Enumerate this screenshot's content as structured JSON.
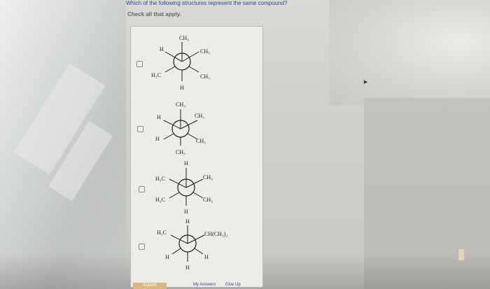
{
  "question": "Which of the following structures represent the same compound?",
  "instruction": "Check all that apply.",
  "options": [
    {
      "front_top": "CH₃",
      "front_left": "H",
      "front_right": "H",
      "back_top_right": "CH₃",
      "back_bottom_left": "H₃C",
      "back_bottom_right": "CH₃",
      "front_bottom": "H"
    },
    {
      "front_top": "CH₃",
      "front_left": "H",
      "front_right": "H",
      "back_top_right": "CH₃",
      "back_bottom_left": "H",
      "back_bottom_right": "CH₃",
      "front_bottom": "CH₃"
    },
    {
      "front_top": "H",
      "front_left": "H₃C",
      "front_right": "H",
      "back_top_right": "CH₃",
      "back_bottom_left": "H₃C",
      "back_bottom_right": "CH₃",
      "front_bottom": "H"
    },
    {
      "front_top": "H",
      "front_left": "H₃C",
      "front_right": "H",
      "back_top_right": "CH(CH₃)₂",
      "back_bottom_left": "H",
      "back_bottom_right": "H",
      "front_bottom": "H"
    }
  ],
  "buttons": {
    "submit": "Submit",
    "my_answers": "My Answers",
    "give_up": "Give Up"
  }
}
